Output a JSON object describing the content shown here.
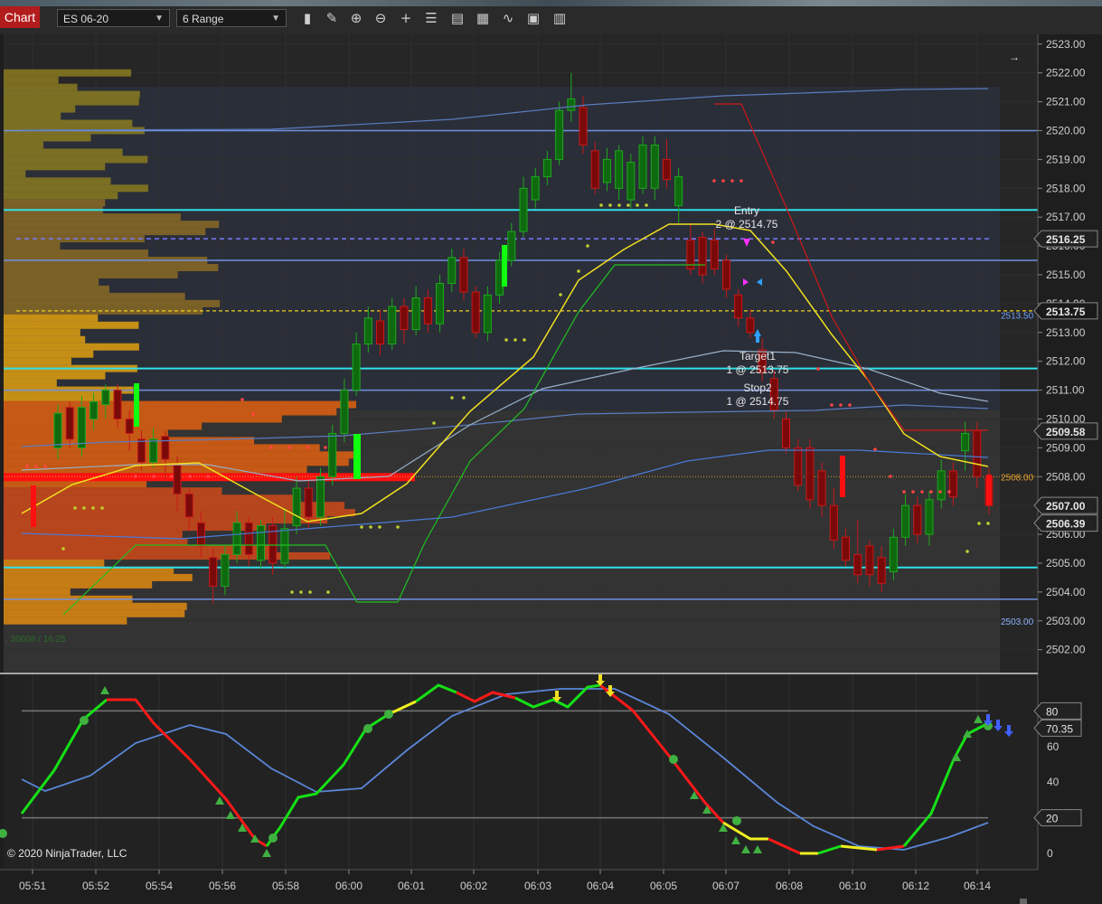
{
  "toolbar": {
    "chart_tab": "Chart",
    "instrument": "ES 06-20",
    "bar_type": "6 Range",
    "icons": [
      "bar-style-icon",
      "draw-tool-icon",
      "zoom-in-icon",
      "zoom-out-icon",
      "crosshair-icon",
      "data-box-icon",
      "properties-icon",
      "strategies-icon",
      "indicators-icon",
      "snapshot-icon",
      "more-icon"
    ]
  },
  "copyright": "© 2020 NinjaTrader, LLC",
  "profile_note": ", 30608 / 16:25",
  "price_axis": {
    "ticks": [
      "2523.00",
      "2522.00",
      "2521.00",
      "2520.00",
      "2519.00",
      "2518.00",
      "2517.00",
      "2516.00",
      "2515.00",
      "2514.00",
      "2513.00",
      "2512.00",
      "2511.00",
      "2510.00",
      "2509.00",
      "2508.00",
      "2507.00",
      "2506.00",
      "2505.00",
      "2504.00",
      "2503.00",
      "2502.00"
    ],
    "markers": [
      {
        "text": "2516.25",
        "price": 2516.25,
        "bg": "#222222"
      },
      {
        "text": "2513.75",
        "price": 2513.75,
        "bg": "#1a1a1a"
      },
      {
        "text": "2509.58",
        "price": 2509.58,
        "bg": "#222222"
      },
      {
        "text": "2507.00",
        "price": 2507.0,
        "bg": "#222222"
      },
      {
        "text": "2506.39",
        "price": 2506.39,
        "bg": "#222222"
      }
    ],
    "inline_labels": [
      {
        "text": "2513.50",
        "price": 2513.6,
        "color": "#6ea0ff"
      },
      {
        "text": "2508.00",
        "price": 2508.0,
        "color": "#e0a030"
      },
      {
        "text": "2503.00",
        "price": 2503.0,
        "color": "#8fb0ff"
      }
    ]
  },
  "osc_axis": {
    "ticks": [
      "80",
      "60",
      "40",
      "20",
      "0"
    ],
    "markers": [
      {
        "text": "80",
        "value": 80
      },
      {
        "text": "70.35",
        "value": 70.35
      },
      {
        "text": "20",
        "value": 20
      }
    ]
  },
  "time_axis": [
    "05:51",
    "05:52",
    "05:54",
    "05:56",
    "05:58",
    "06:00",
    "06:01",
    "06:02",
    "06:03",
    "06:04",
    "06:05",
    "06:07",
    "06:08",
    "06:10",
    "06:12",
    "06:14"
  ],
  "orders": [
    {
      "title": "Entry",
      "detail": "2 @ 2514.75"
    },
    {
      "title": "Target1",
      "detail": "1 @ 2513.75"
    },
    {
      "title": "Stop2",
      "detail": "1 @ 2514.75"
    }
  ],
  "chart_data": {
    "type": "candlestick",
    "instrument": "ES 06-20",
    "ylim": [
      2501.5,
      2523.3
    ],
    "oscillator_ylim": [
      -5,
      95
    ],
    "levels": {
      "cyan": [
        2517.25,
        2511.75,
        2504.85
      ],
      "blue": [
        2520.0,
        2515.5,
        2511.0,
        2503.75
      ],
      "dashed_blue": 2516.25,
      "dashed_yellow": 2513.75,
      "dotted_orange": 2508.0
    },
    "candles": [
      {
        "o": 2509.0,
        "c": 2510.2,
        "h": 2510.5,
        "l": 2508.6
      },
      {
        "o": 2510.4,
        "c": 2509.3,
        "h": 2510.6,
        "l": 2509.0
      },
      {
        "o": 2509.0,
        "c": 2510.4,
        "h": 2510.8,
        "l": 2508.7
      },
      {
        "o": 2510.0,
        "c": 2510.6,
        "h": 2510.9,
        "l": 2509.6
      },
      {
        "o": 2510.5,
        "c": 2511.0,
        "h": 2511.2,
        "l": 2510.0
      },
      {
        "o": 2511.0,
        "c": 2510.0,
        "h": 2511.2,
        "l": 2509.7
      },
      {
        "o": 2510.0,
        "c": 2509.5,
        "h": 2510.3,
        "l": 2508.9
      },
      {
        "o": 2509.3,
        "c": 2508.5,
        "h": 2509.6,
        "l": 2508.2
      },
      {
        "o": 2508.5,
        "c": 2509.3,
        "h": 2509.7,
        "l": 2508.3
      },
      {
        "o": 2509.4,
        "c": 2508.6,
        "h": 2509.6,
        "l": 2507.9
      },
      {
        "o": 2508.4,
        "c": 2507.4,
        "h": 2508.7,
        "l": 2506.8
      },
      {
        "o": 2507.4,
        "c": 2506.6,
        "h": 2507.6,
        "l": 2506.1
      },
      {
        "o": 2506.4,
        "c": 2505.6,
        "h": 2506.8,
        "l": 2505.2
      },
      {
        "o": 2505.2,
        "c": 2504.2,
        "h": 2505.5,
        "l": 2503.6
      },
      {
        "o": 2504.2,
        "c": 2505.3,
        "h": 2505.6,
        "l": 2503.9
      },
      {
        "o": 2505.3,
        "c": 2506.4,
        "h": 2506.8,
        "l": 2505.0
      },
      {
        "o": 2506.4,
        "c": 2505.3,
        "h": 2506.6,
        "l": 2504.9
      },
      {
        "o": 2505.1,
        "c": 2506.3,
        "h": 2506.5,
        "l": 2504.8
      },
      {
        "o": 2506.3,
        "c": 2505.0,
        "h": 2506.6,
        "l": 2504.6
      },
      {
        "o": 2505.0,
        "c": 2506.2,
        "h": 2506.9,
        "l": 2504.8
      },
      {
        "o": 2506.3,
        "c": 2507.6,
        "h": 2508.0,
        "l": 2506.0
      },
      {
        "o": 2507.6,
        "c": 2506.6,
        "h": 2507.9,
        "l": 2506.2
      },
      {
        "o": 2506.6,
        "c": 2508.0,
        "h": 2508.3,
        "l": 2506.3
      },
      {
        "o": 2508.0,
        "c": 2509.5,
        "h": 2509.8,
        "l": 2507.7
      },
      {
        "o": 2509.5,
        "c": 2511.0,
        "h": 2511.4,
        "l": 2509.2
      },
      {
        "o": 2511.0,
        "c": 2512.6,
        "h": 2513.0,
        "l": 2510.8
      },
      {
        "o": 2512.6,
        "c": 2513.5,
        "h": 2513.9,
        "l": 2512.3
      },
      {
        "o": 2513.4,
        "c": 2512.6,
        "h": 2513.8,
        "l": 2512.2
      },
      {
        "o": 2512.6,
        "c": 2513.9,
        "h": 2514.2,
        "l": 2512.4
      },
      {
        "o": 2513.9,
        "c": 2513.1,
        "h": 2514.2,
        "l": 2512.6
      },
      {
        "o": 2513.1,
        "c": 2514.2,
        "h": 2514.6,
        "l": 2512.9
      },
      {
        "o": 2514.2,
        "c": 2513.3,
        "h": 2514.5,
        "l": 2513.0
      },
      {
        "o": 2513.3,
        "c": 2514.7,
        "h": 2515.0,
        "l": 2513.0
      },
      {
        "o": 2514.7,
        "c": 2515.6,
        "h": 2515.9,
        "l": 2514.4
      },
      {
        "o": 2515.6,
        "c": 2514.4,
        "h": 2515.9,
        "l": 2514.1
      },
      {
        "o": 2514.4,
        "c": 2513.0,
        "h": 2514.6,
        "l": 2512.8
      },
      {
        "o": 2513.0,
        "c": 2514.3,
        "h": 2514.6,
        "l": 2512.7
      },
      {
        "o": 2514.3,
        "c": 2515.5,
        "h": 2515.8,
        "l": 2514.0
      },
      {
        "o": 2515.5,
        "c": 2516.5,
        "h": 2516.8,
        "l": 2515.3
      },
      {
        "o": 2516.5,
        "c": 2518.0,
        "h": 2518.4,
        "l": 2516.3
      },
      {
        "o": 2517.6,
        "c": 2518.4,
        "h": 2518.7,
        "l": 2517.3
      },
      {
        "o": 2518.4,
        "c": 2519.0,
        "h": 2519.3,
        "l": 2518.1
      },
      {
        "o": 2519.0,
        "c": 2520.7,
        "h": 2521.0,
        "l": 2518.8
      },
      {
        "o": 2520.7,
        "c": 2521.1,
        "h": 2522.0,
        "l": 2520.3
      },
      {
        "o": 2520.8,
        "c": 2519.5,
        "h": 2521.2,
        "l": 2519.2
      },
      {
        "o": 2519.3,
        "c": 2518.0,
        "h": 2519.6,
        "l": 2517.8
      },
      {
        "o": 2518.2,
        "c": 2519.0,
        "h": 2519.4,
        "l": 2517.9
      },
      {
        "o": 2518.0,
        "c": 2519.3,
        "h": 2519.5,
        "l": 2517.6
      },
      {
        "o": 2517.6,
        "c": 2518.9,
        "h": 2519.2,
        "l": 2517.3
      },
      {
        "o": 2518.0,
        "c": 2519.5,
        "h": 2519.8,
        "l": 2517.8
      },
      {
        "o": 2518.0,
        "c": 2519.5,
        "h": 2519.8,
        "l": 2517.6
      },
      {
        "o": 2519.0,
        "c": 2518.3,
        "h": 2519.7,
        "l": 2518.0
      },
      {
        "o": 2517.4,
        "c": 2518.4,
        "h": 2518.7,
        "l": 2516.8
      },
      {
        "o": 2516.2,
        "c": 2515.2,
        "h": 2516.8,
        "l": 2515.0
      },
      {
        "o": 2516.3,
        "c": 2515.0,
        "h": 2516.5,
        "l": 2514.7
      },
      {
        "o": 2516.2,
        "c": 2515.2,
        "h": 2516.6,
        "l": 2515.0
      },
      {
        "o": 2515.5,
        "c": 2514.5,
        "h": 2515.7,
        "l": 2514.2
      },
      {
        "o": 2514.3,
        "c": 2513.5,
        "h": 2514.5,
        "l": 2513.2
      },
      {
        "o": 2513.5,
        "c": 2513.0,
        "h": 2513.8,
        "l": 2512.8
      },
      {
        "o": 2512.4,
        "c": 2511.6,
        "h": 2512.8,
        "l": 2511.3
      },
      {
        "o": 2511.4,
        "c": 2510.3,
        "h": 2511.7,
        "l": 2510.0
      },
      {
        "o": 2510.0,
        "c": 2509.0,
        "h": 2510.3,
        "l": 2508.8
      },
      {
        "o": 2509.0,
        "c": 2507.7,
        "h": 2509.3,
        "l": 2507.5
      },
      {
        "o": 2509.0,
        "c": 2507.2,
        "h": 2509.3,
        "l": 2506.9
      },
      {
        "o": 2508.2,
        "c": 2507.0,
        "h": 2508.5,
        "l": 2506.6
      },
      {
        "o": 2507.0,
        "c": 2505.8,
        "h": 2507.6,
        "l": 2505.5
      },
      {
        "o": 2505.9,
        "c": 2505.1,
        "h": 2506.2,
        "l": 2504.9
      },
      {
        "o": 2505.3,
        "c": 2504.6,
        "h": 2506.5,
        "l": 2504.3
      },
      {
        "o": 2505.6,
        "c": 2504.6,
        "h": 2505.8,
        "l": 2504.2
      },
      {
        "o": 2505.2,
        "c": 2504.3,
        "h": 2505.6,
        "l": 2504.0
      },
      {
        "o": 2504.7,
        "c": 2505.9,
        "h": 2506.2,
        "l": 2504.4
      },
      {
        "o": 2505.9,
        "c": 2507.0,
        "h": 2507.4,
        "l": 2505.6
      },
      {
        "o": 2507.0,
        "c": 2506.0,
        "h": 2507.3,
        "l": 2505.7
      },
      {
        "o": 2506.0,
        "c": 2507.2,
        "h": 2507.5,
        "l": 2505.6
      },
      {
        "o": 2507.2,
        "c": 2508.2,
        "h": 2508.6,
        "l": 2506.9
      },
      {
        "o": 2508.2,
        "c": 2507.3,
        "h": 2508.5,
        "l": 2507.0
      },
      {
        "o": 2508.9,
        "c": 2509.5,
        "h": 2509.9,
        "l": 2508.2
      },
      {
        "o": 2509.6,
        "c": 2508.0,
        "h": 2509.9,
        "l": 2507.6
      },
      {
        "o": 2508.0,
        "c": 2507.0,
        "h": 2508.3,
        "l": 2506.7
      }
    ]
  }
}
